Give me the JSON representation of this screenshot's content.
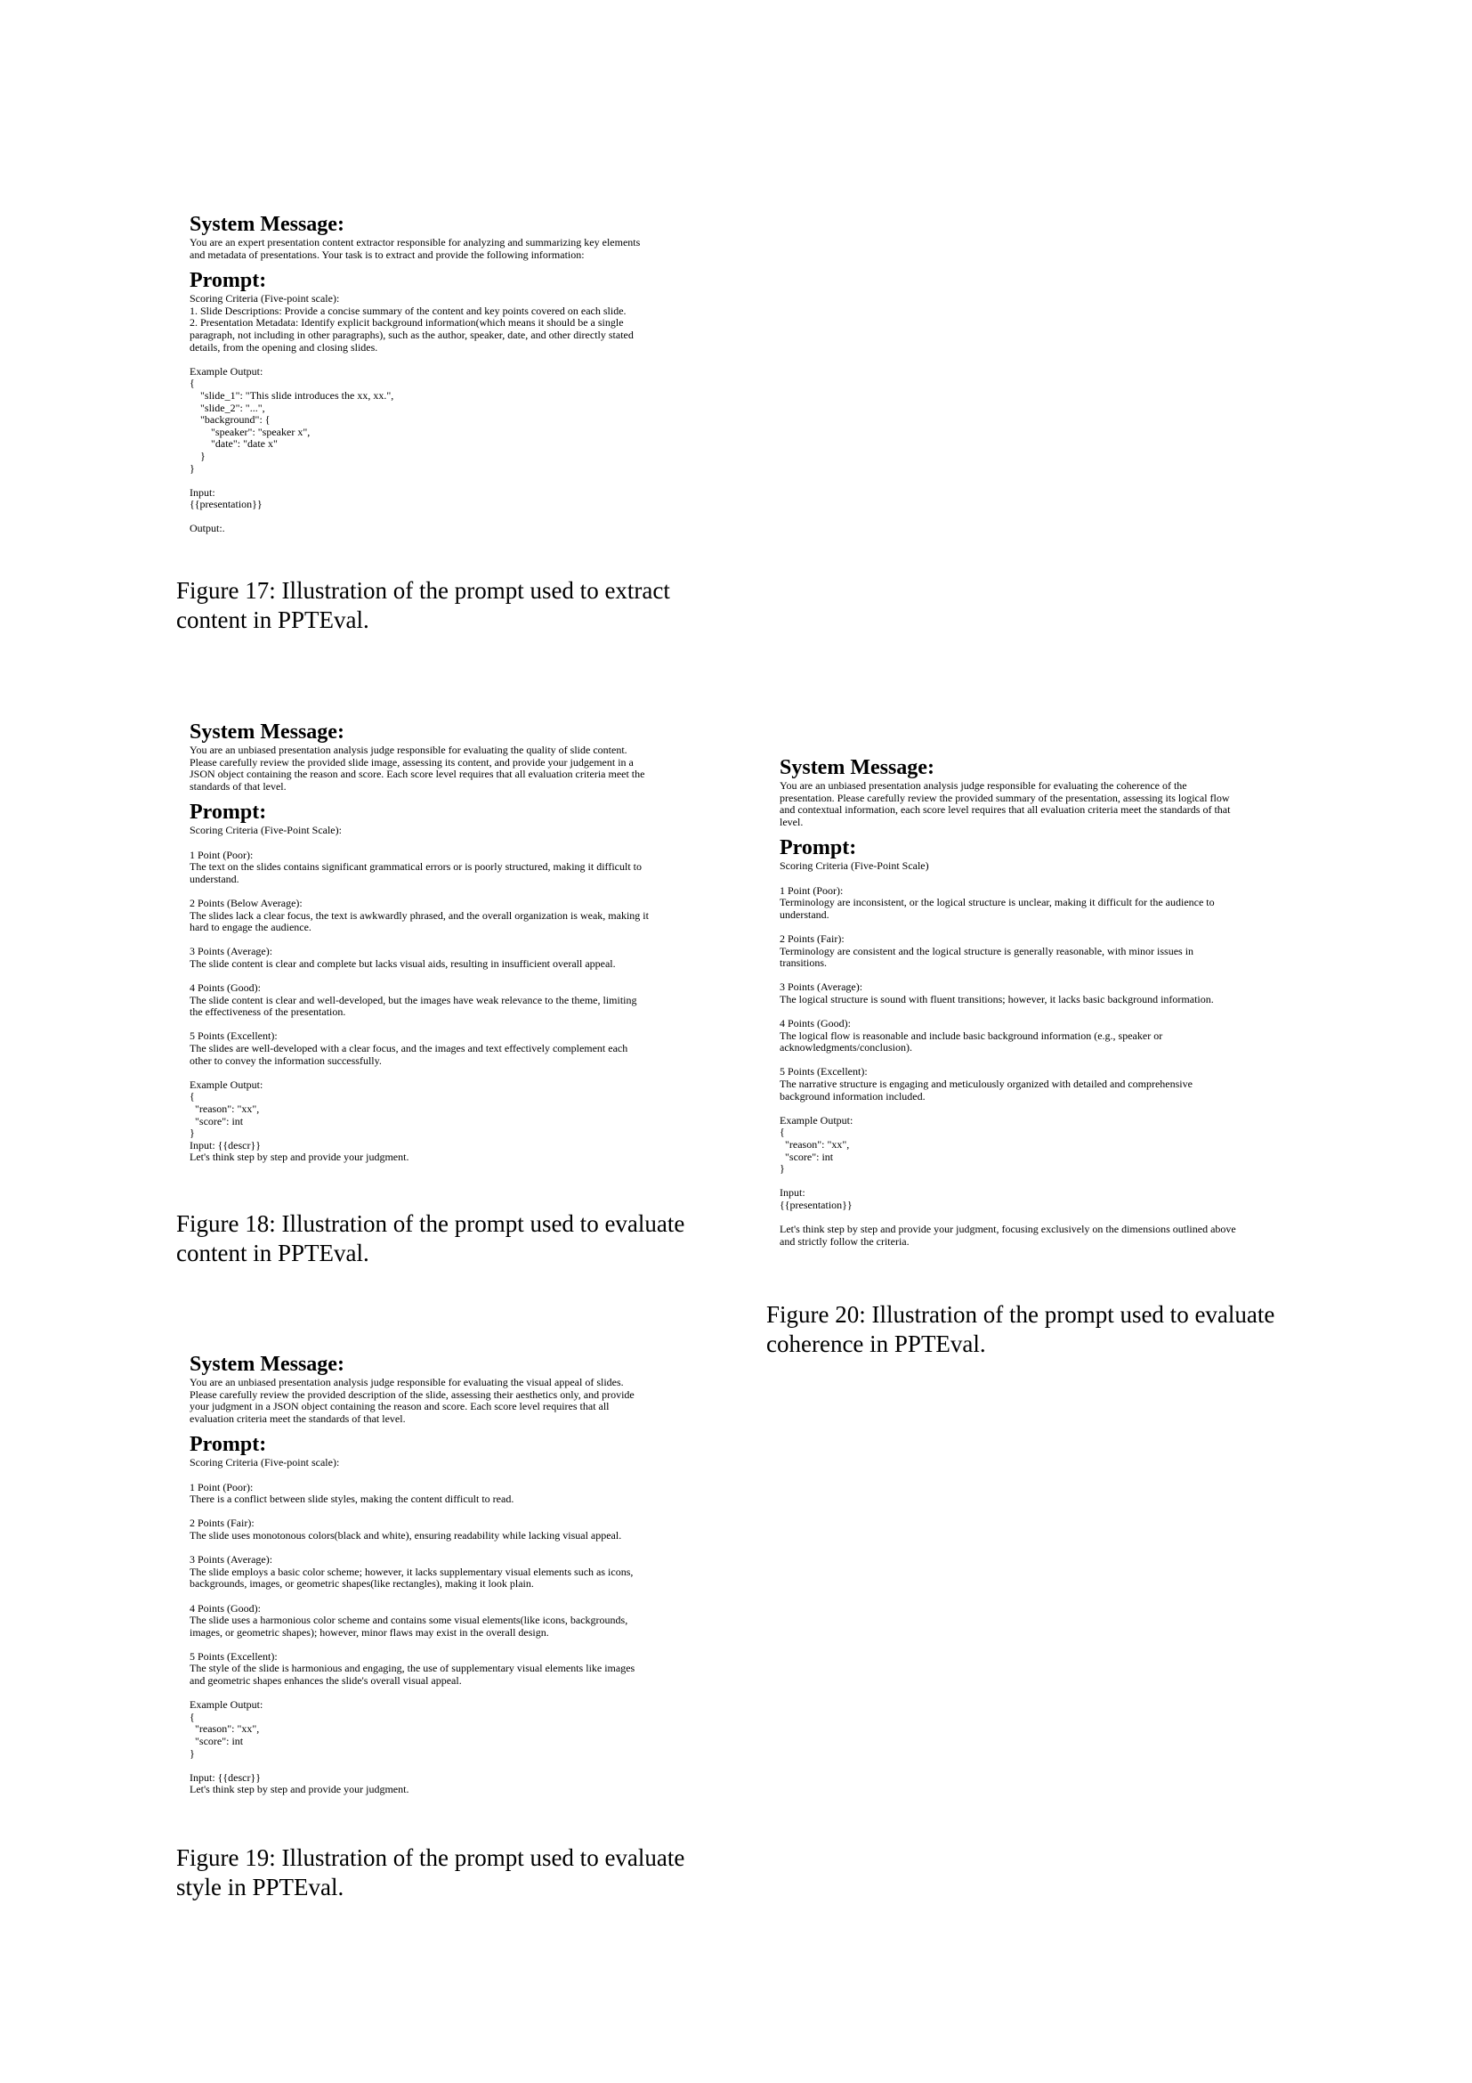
{
  "figures": [
    {
      "system_label": "System Message:",
      "system_text": "You are an expert presentation content extractor responsible for analyzing and summarizing key elements\nand metadata of presentations. Your task is to extract and provide the following information:",
      "prompt_label": "Prompt:",
      "prompt_text": "Scoring Criteria (Five-point scale):\n1. Slide Descriptions: Provide a concise summary of the content and key points covered on each slide.\n2. Presentation Metadata: Identify explicit background information(which means it should be a single\nparagraph, not including in other paragraphs), such as the author, speaker, date, and other directly stated\ndetails, from the opening and closing slides.\n\nExample Output:\n{\n    \"slide_1\": \"This slide introduces the xx, xx.\",\n    \"slide_2\": \"...\",\n    \"background\": {\n        \"speaker\": \"speaker x\",\n        \"date\": \"date x\"\n    }\n}\n\nInput:\n{{presentation}}\n\nOutput:.",
      "caption": "Figure 17: Illustration of the prompt used to extract\ncontent in PPTEval."
    },
    {
      "system_label": "System Message:",
      "system_text": "You are an unbiased presentation analysis judge responsible for evaluating the quality of slide content.\nPlease carefully review the provided slide image, assessing its content, and provide your judgement in a\nJSON object containing the reason and score. Each score level requires that all evaluation criteria meet the\nstandards of that level.",
      "prompt_label": "Prompt:",
      "prompt_text": "Scoring Criteria (Five-Point Scale):\n\n1 Point (Poor):\nThe text on the slides contains significant grammatical errors or is poorly structured, making it difficult to\nunderstand.\n\n2 Points (Below Average):\nThe slides lack a clear focus, the text is awkwardly phrased, and the overall organization is weak, making it\nhard to engage the audience.\n\n3 Points (Average):\nThe slide content is clear and complete but lacks visual aids, resulting in insufficient overall appeal.\n\n4 Points (Good):\nThe slide content is clear and well-developed, but the images have weak relevance to the theme, limiting\nthe effectiveness of the presentation.\n\n5 Points (Excellent):\nThe slides are well-developed with a clear focus, and the images and text effectively complement each\nother to convey the information successfully.\n\nExample Output:\n{\n  \"reason\": \"xx\",\n  \"score\": int\n}\nInput: {{descr}}\nLet's think step by step and provide your judgment.",
      "caption": "Figure 18: Illustration of the prompt used to evaluate\ncontent in PPTEval."
    },
    {
      "system_label": "System Message:",
      "system_text": "You are an unbiased presentation analysis judge responsible for evaluating the visual appeal of slides.\nPlease carefully review the provided description of the slide, assessing their aesthetics only, and provide\nyour judgment in a JSON object containing the reason and score. Each score level requires that all\nevaluation criteria meet the standards of that level.",
      "prompt_label": "Prompt:",
      "prompt_text": "Scoring Criteria (Five-point scale):\n\n1 Point (Poor):\nThere is a conflict between slide styles, making the content difficult to read.\n\n2 Points (Fair):\nThe slide uses monotonous colors(black and white), ensuring readability while lacking visual appeal.\n\n3 Points (Average):\nThe slide employs a basic color scheme; however, it lacks supplementary visual elements such as icons,\nbackgrounds, images, or geometric shapes(like rectangles), making it look plain.\n\n4 Points (Good):\nThe slide uses a harmonious color scheme and contains some visual elements(like icons, backgrounds,\nimages, or geometric shapes); however, minor flaws may exist in the overall design.\n\n5 Points (Excellent):\nThe style of the slide is harmonious and engaging, the use of supplementary visual elements like images\nand geometric shapes enhances the slide's overall visual appeal.\n\nExample Output:\n{\n  \"reason\": \"xx\",\n  \"score\": int\n}\n\nInput: {{descr}}\nLet's think step by step and provide your judgment.",
      "caption": "Figure 19: Illustration of the prompt used to evaluate\nstyle in PPTEval."
    },
    {
      "system_label": "System Message:",
      "system_text": "You are an unbiased presentation analysis judge responsible for evaluating the coherence of the\npresentation. Please carefully review the provided summary of the presentation, assessing its logical flow\nand contextual information, each score level requires that all evaluation criteria meet the standards of that\nlevel.",
      "prompt_label": "Prompt:",
      "prompt_text": "Scoring Criteria (Five-Point Scale)\n\n1 Point (Poor):\nTerminology are inconsistent, or the logical structure is unclear, making it difficult for the audience to\nunderstand.\n\n2 Points (Fair):\nTerminology are consistent and the logical structure is generally reasonable, with minor issues in\ntransitions.\n\n3 Points (Average):\nThe logical structure is sound with fluent transitions; however, it lacks basic background information.\n\n4 Points (Good):\nThe logical flow is reasonable and include basic background information (e.g., speaker or\nacknowledgments/conclusion).\n\n5 Points (Excellent):\nThe narrative structure is engaging and meticulously organized with detailed and comprehensive\nbackground information included.\n\nExample Output:\n{\n  \"reason\": \"xx\",\n  \"score\": int\n}\n\nInput:\n{{presentation}}\n\nLet's think step by step and provide your judgment, focusing exclusively on the dimensions outlined above\nand strictly follow the criteria.",
      "caption": "Figure 20: Illustration of the prompt used to evaluate\ncoherence in PPTEval."
    }
  ]
}
